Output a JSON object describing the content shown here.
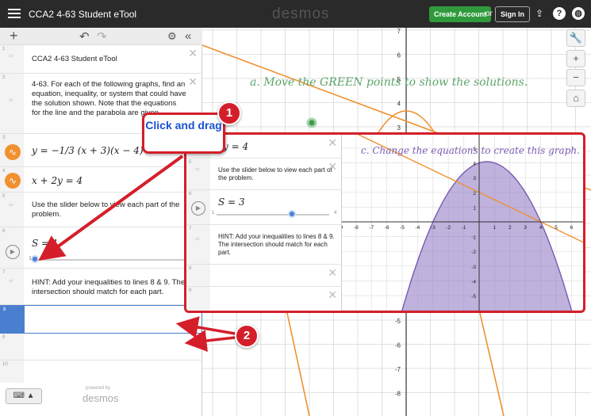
{
  "topbar": {
    "title": "CCA2 4-63 Student eTool",
    "brand": "desmos",
    "create_account": "Create Account",
    "or": "or",
    "sign_in": "Sign In"
  },
  "sidebar": {
    "rows": [
      {
        "num": "1",
        "text": "CCA2 4-63  Student eTool"
      },
      {
        "num": "2",
        "text": "4-63.  For each of the following graphs, find an equation, inequality, or system that could have the solution shown. Note that the equations for the line and the parabola are given."
      },
      {
        "num": "3",
        "math": "y = −1/3 (x + 3)(x − 4)"
      },
      {
        "num": "4",
        "math": "x + 2y = 4"
      },
      {
        "num": "5",
        "text": "Use the slider below to view each part of the problem."
      },
      {
        "num": "6",
        "math": "S = 1",
        "slider_min": "1",
        "slider_value": 1
      },
      {
        "num": "7",
        "text": "HINT: Add your inequalities to lines 8 & 9. The intersection should match for each part."
      },
      {
        "num": "8"
      },
      {
        "num": "9"
      },
      {
        "num": "10"
      }
    ],
    "powered_by": "powered by",
    "logo": "desmos"
  },
  "graph": {
    "caption": "a. Move the GREEN points to show the solutions.",
    "y_ticks": [
      "7",
      "6",
      "5",
      "4",
      "3",
      "-5",
      "-6",
      "-7",
      "-8"
    ]
  },
  "inset": {
    "rows": [
      {
        "num": "4",
        "math": "y = 4"
      },
      {
        "num": "5",
        "text": "Use the slider below to view each part of the problem."
      },
      {
        "num": "6",
        "math": "S = 3",
        "slider_min": "1",
        "slider_max": "4",
        "slider_value": 3
      },
      {
        "num": "7",
        "text": "HINT: Add your inequalities to lines 8 & 9. The intersection should match for each part."
      },
      {
        "num": "8"
      },
      {
        "num": "9"
      }
    ],
    "caption": "c. Change the equations to create this graph.",
    "x_ticks": [
      "-9",
      "-8",
      "-7",
      "-6",
      "-5",
      "-4",
      "-3",
      "-2",
      "-1",
      "1",
      "2",
      "3",
      "4",
      "5",
      "6"
    ],
    "y_ticks": [
      "5",
      "4",
      "3",
      "2",
      "1",
      "-1",
      "-2",
      "-3",
      "-4",
      "-5"
    ]
  },
  "annotations": {
    "callout_text": "Click and drag",
    "badge1": "1",
    "badge2": "2"
  },
  "colors": {
    "orange": "#f0902f",
    "purple": "#7a5bb0",
    "green": "#3f9a4c",
    "red": "#d41f2a",
    "blue": "#1a52d0"
  }
}
